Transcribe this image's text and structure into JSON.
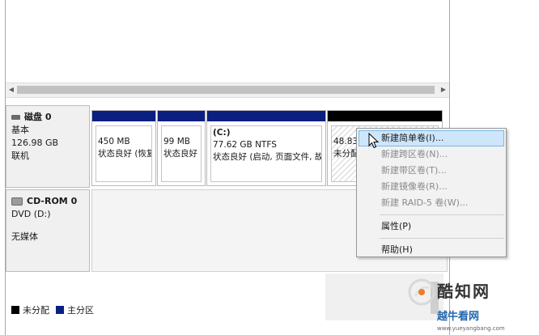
{
  "disks": [
    {
      "name": "磁盘 0",
      "type": "基本",
      "size": "126.98 GB",
      "status": "联机",
      "partitions": [
        {
          "label": "",
          "size": "450 MB",
          "status": "状态良好 (恢复"
        },
        {
          "label": "",
          "size": "99 MB",
          "status": "状态良好 (E"
        },
        {
          "label": "(C:)",
          "size": "77.62 GB NTFS",
          "status": "状态良好 (启动, 页面文件, 故"
        },
        {
          "label": "",
          "size": "48.83",
          "status": "未分配"
        }
      ]
    },
    {
      "name": "CD-ROM 0",
      "drive": "DVD (D:)",
      "media": "无媒体"
    }
  ],
  "context_menu": {
    "items": [
      {
        "label": "新建简单卷(I)...",
        "enabled": true,
        "highlighted": true
      },
      {
        "label": "新建跨区卷(N)...",
        "enabled": false
      },
      {
        "label": "新建带区卷(T)...",
        "enabled": false
      },
      {
        "label": "新建镜像卷(R)...",
        "enabled": false
      },
      {
        "label": "新建 RAID-5 卷(W)...",
        "enabled": false
      },
      {
        "label": "属性(P)",
        "enabled": true
      },
      {
        "label": "帮助(H)",
        "enabled": true
      }
    ]
  },
  "legend": [
    {
      "label": "未分配",
      "color": "#000000"
    },
    {
      "label": "主分区",
      "color": "#0b1f80"
    }
  ],
  "watermark": {
    "line1": "酷知网",
    "line2": "越牛看网",
    "line3": "www.yueyangbang.com"
  },
  "colors": {
    "primary_partition": "#0b1f80",
    "unallocated": "#000000",
    "menu_highlight": "#cde6fb"
  }
}
